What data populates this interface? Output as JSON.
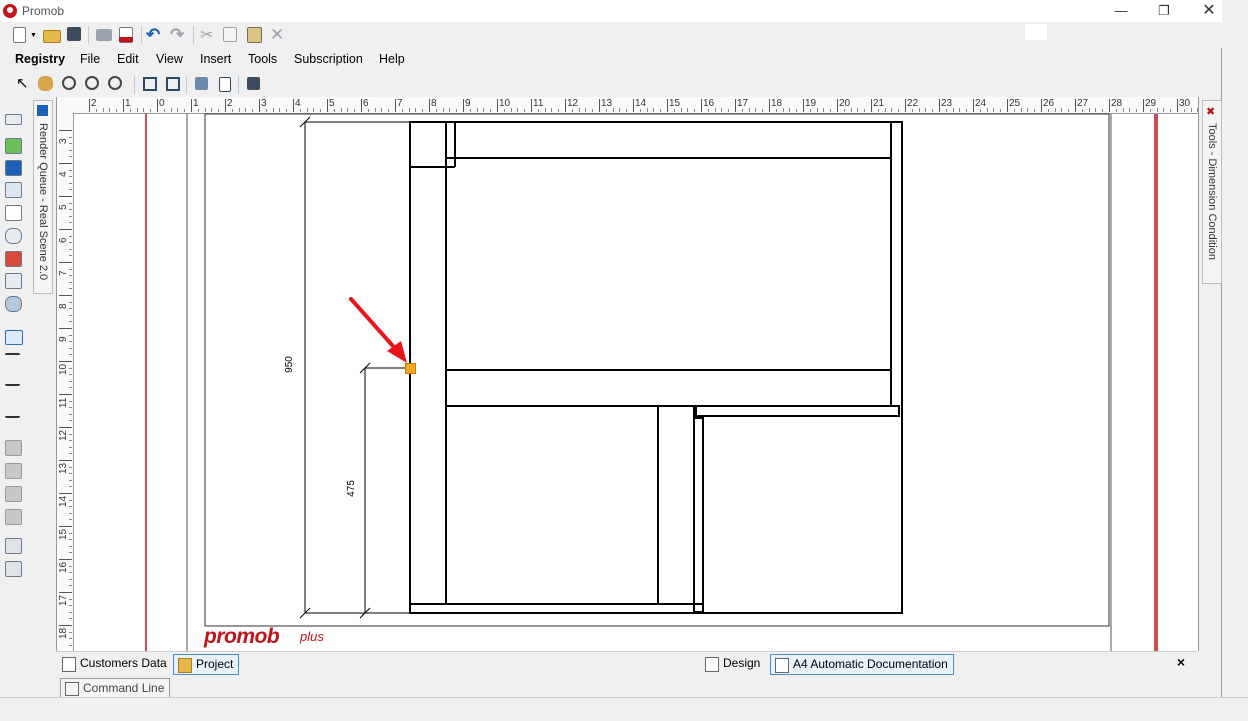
{
  "window": {
    "title": "Promob",
    "controls": [
      "minimize-icon",
      "restore-icon",
      "close-icon"
    ]
  },
  "toolbar1": {
    "icons": [
      "new-file-icon",
      "open-folder-icon",
      "save-icon",
      "print-icon",
      "pdf-icon",
      "undo-icon",
      "redo-icon",
      "cut-icon",
      "copy-icon",
      "paste-icon",
      "delete-icon"
    ]
  },
  "menu": {
    "items": [
      "Registry",
      "File",
      "Edit",
      "View",
      "Insert",
      "Tools",
      "Subscription",
      "Help"
    ]
  },
  "toolbar3": {
    "icons": [
      "select-arrow-icon",
      "pan-hand-icon",
      "zoom-window-icon",
      "zoom-out-icon",
      "zoom-in-icon",
      "fit-page-icon",
      "fit-selection-icon",
      "layers-icon",
      "page-icon",
      "paint-icon"
    ]
  },
  "left_toolbar": {
    "icons": [
      "rectangle-tool-icon",
      "image-tool-icon",
      "text-tool-icon",
      "camera-view-icon",
      "list-tool-icon",
      "symbol-tool-icon",
      "render-icon",
      "frame-tool-icon",
      "measure-icon",
      "linear-dimension-icon",
      "aligned-dimension-icon",
      "angle-dimension-icon",
      "level-dimension-icon",
      "group-icon",
      "ungroup-icon",
      "align-center-icon",
      "distribute-icon",
      "bring-front-icon",
      "send-back-icon"
    ]
  },
  "side_tabs": {
    "left": "Render Queue - Real Scene 2.0",
    "right": "Tools - Dimension Condition"
  },
  "ruler": {
    "h_labels": [
      "2",
      "1",
      "0",
      "1",
      "2",
      "3",
      "4",
      "5",
      "6",
      "7",
      "8",
      "9",
      "10",
      "11",
      "12",
      "13",
      "14",
      "15",
      "16",
      "17",
      "18",
      "19",
      "20",
      "21",
      "22",
      "23",
      "24",
      "25",
      "26",
      "27",
      "28",
      "29",
      "30"
    ],
    "v_labels": [
      "3",
      "4",
      "5",
      "6",
      "7",
      "8",
      "9",
      "10",
      "11",
      "12",
      "13",
      "14",
      "15",
      "16",
      "17",
      "18"
    ]
  },
  "drawing": {
    "dimension_total": "950",
    "dimension_half": "475",
    "logo_main": "promob",
    "logo_sub": "plus",
    "marker_color": "#f5a623",
    "arrow_color": "#e8161b",
    "margin_line_color": "#c0141b"
  },
  "tabs": {
    "left": [
      {
        "label": "Customers Data",
        "icon": "document-icon",
        "active": false
      },
      {
        "label": "Project",
        "icon": "folder-icon",
        "active": true
      }
    ],
    "right": [
      {
        "label": "Design",
        "icon": "design-icon",
        "active": false
      },
      {
        "label": "A4 Automatic Documentation",
        "icon": "a4-document-icon",
        "active": true
      }
    ],
    "close": "×"
  },
  "command_line": {
    "label": "Command Line"
  }
}
